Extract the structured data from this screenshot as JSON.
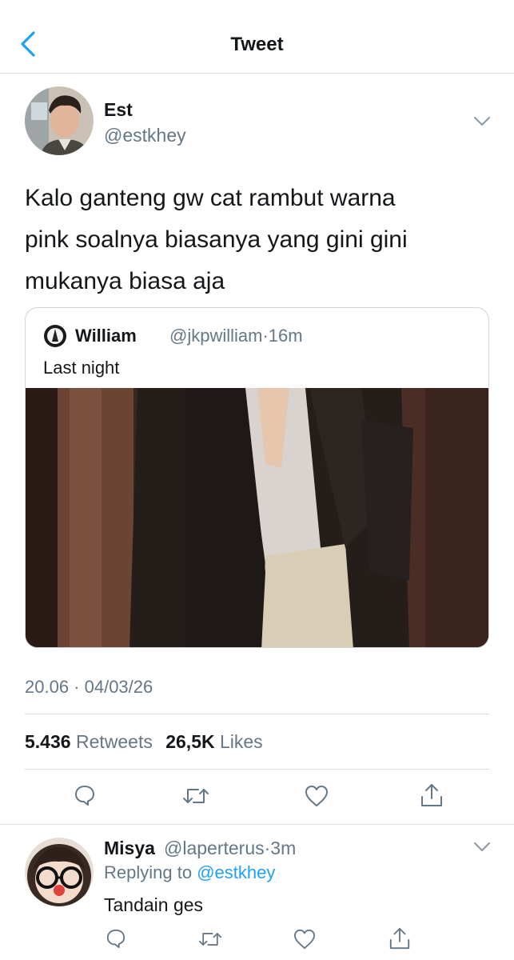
{
  "nav": {
    "title": "Tweet",
    "back_icon": "chevron-left-icon",
    "accent": "#1da1f2"
  },
  "tweet": {
    "author_name": "Est",
    "author_handle": "@estkhey",
    "text_lines": [
      "Kalo ganteng gw cat rambut warna",
      "pink soalnya biasanya yang gini gini",
      "mukanya biasa aja"
    ],
    "quote": {
      "author_name": "William",
      "author_handle": "@jkpwilliam",
      "time": "16m",
      "text": "Last night"
    },
    "timestamp": "20.06 · 04/03/26",
    "stats": {
      "retweets_count": "5.436",
      "retweets_label": "Retweets",
      "likes_count": "26,5K",
      "likes_label": "Likes"
    },
    "actions": [
      "reply-icon",
      "retweet-icon",
      "like-icon",
      "share-icon"
    ]
  },
  "reply": {
    "author_name": "Misya",
    "author_handle": "@laperterus",
    "time": "3m",
    "replying_prefix": "Replying to",
    "replying_handle": "@estkhey",
    "text": "Tandain ges"
  },
  "colors": {
    "text": "#14171a",
    "secondary": "#657786",
    "divider": "#d9dde0"
  }
}
